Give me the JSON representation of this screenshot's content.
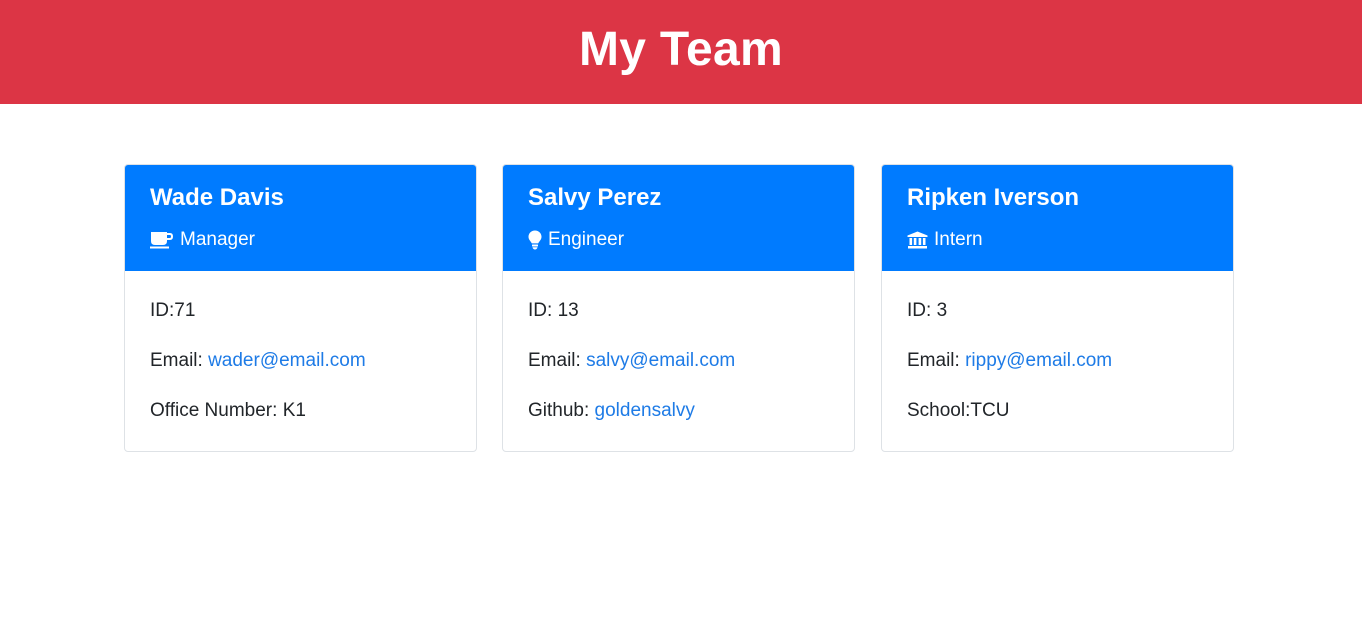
{
  "header": {
    "title": "My Team"
  },
  "team": [
    {
      "name": "Wade Davis",
      "role": "Manager",
      "role_icon": "mug-icon",
      "id_label": "ID:",
      "id": "71",
      "email_label": "Email: ",
      "email": "wader@email.com",
      "extra_label": "Office Number: ",
      "extra_value": "K1"
    },
    {
      "name": "Salvy Perez",
      "role": "Engineer",
      "role_icon": "lightbulb-icon",
      "id_label": "ID: ",
      "id": "13",
      "email_label": "Email: ",
      "email": "salvy@email.com",
      "extra_label": "Github: ",
      "extra_value": "goldensalvy"
    },
    {
      "name": "Ripken Iverson",
      "role": "Intern",
      "role_icon": "school-building-icon",
      "id_label": "ID: ",
      "id": "3",
      "email_label": "Email: ",
      "email": "rippy@email.com",
      "extra_label": "School:",
      "extra_value": "TCU"
    }
  ],
  "colors": {
    "header_bg": "#dc3545",
    "card_header_bg": "#007bff",
    "link": "#1e7be6"
  }
}
